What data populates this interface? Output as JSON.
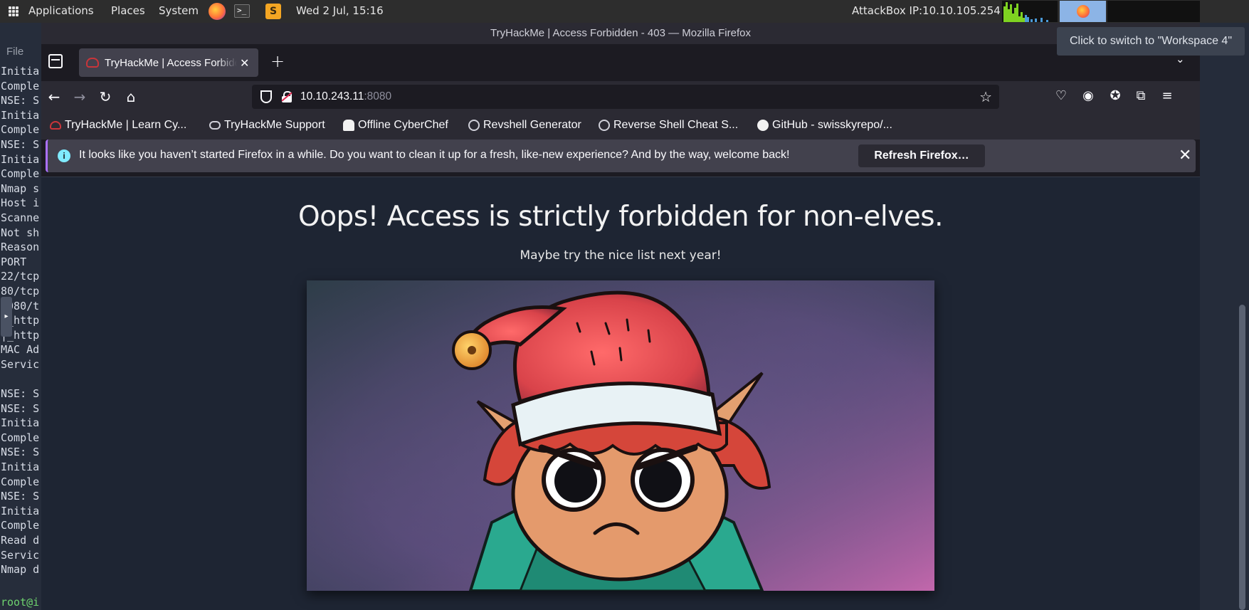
{
  "panel": {
    "menus": [
      "Applications",
      "Places",
      "System"
    ],
    "clock": "Wed  2 Jul, 15:16",
    "attackbox": "AttackBox IP:10.10.105.254"
  },
  "tooltip": "Click to switch to \"Workspace 4\"",
  "terminal": {
    "file_menu": "File",
    "lines": "Initia\nComple\nNSE: S\nInitia\nComple\nNSE: S\nInitia\nComple\nNmap s\nHost i\nScanne\nNot sh\nReason\nPORT  \n22/tcp\n80/tcp\n8080/t\n|_http\n|_http\nMAC Ad\nServic\n\nNSE: S\nNSE: S\nInitia\nComple\nNSE: S\nInitia\nComple\nNSE: S\nInitia\nComple\nRead d\nServic\nNmap d",
    "prompt": "root@i"
  },
  "firefox": {
    "window_title": "TryHackMe | Access Forbidden - 403 — Mozilla Firefox",
    "tab_title": "TryHackMe | Access Forbidden - 403",
    "url_host": "10.10.243.11",
    "url_port": ":8080",
    "bookmarks": [
      {
        "label": "TryHackMe | Learn Cy...",
        "icon": "thm-icon",
        "color": "#c9353a"
      },
      {
        "label": "TryHackMe Support",
        "icon": "cloud-icon",
        "color": "#cfcfd8"
      },
      {
        "label": "Offline CyberChef",
        "icon": "chef-hat-icon",
        "color": "#ffffff"
      },
      {
        "label": "Revshell Generator",
        "icon": "globe-icon",
        "color": "#cfcfd8"
      },
      {
        "label": "Reverse Shell Cheat S...",
        "icon": "globe-icon",
        "color": "#cfcfd8"
      },
      {
        "label": "GitHub - swisskyrepo/...",
        "icon": "github-icon",
        "color": "#ffffff"
      }
    ],
    "notification": {
      "message": "It looks like you haven’t started Firefox in a while. Do you want to clean it up for a fresh, like-new experience? And by the way, welcome back!",
      "button": "Refresh Firefox…"
    }
  },
  "page": {
    "heading": "Oops! Access is strictly forbidden for non-elves.",
    "subheading": "Maybe try the nice list next year!",
    "image_description": "angry-elf-illustration"
  },
  "colors": {
    "page_bg": "#1e2533",
    "firefox_chrome": "#2b2a33",
    "accent": "#ab71ff"
  }
}
